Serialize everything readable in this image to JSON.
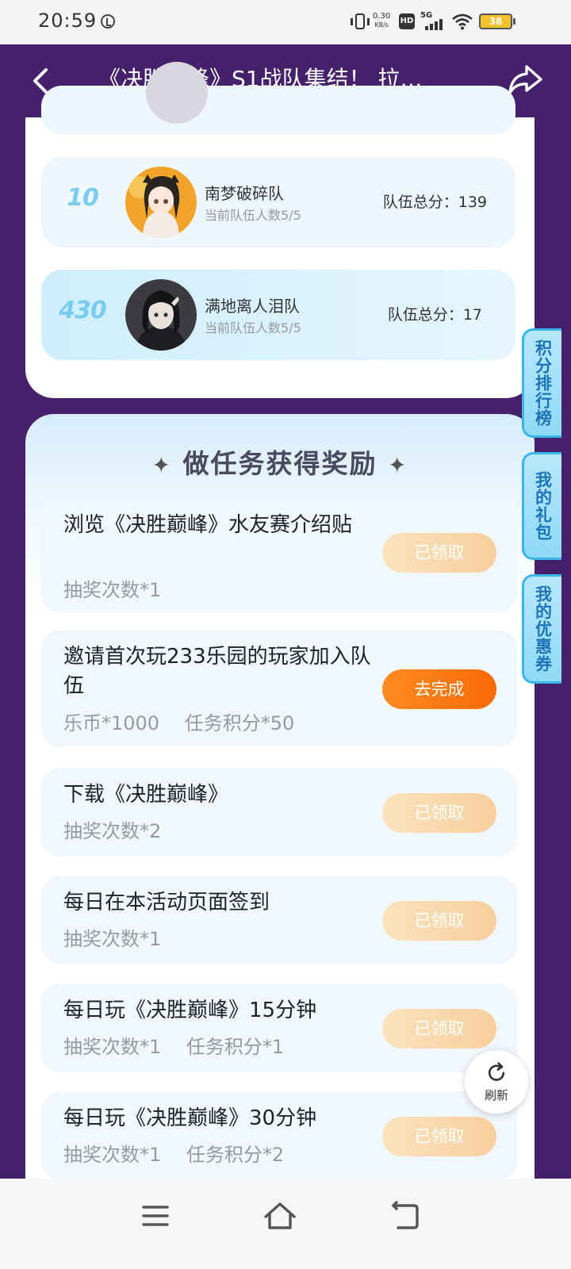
{
  "status_bar": {
    "time": "20:59",
    "net_speed_value": "0.30",
    "net_speed_unit": "KB/s",
    "hd": "HD",
    "network": "5G",
    "battery": "38"
  },
  "header": {
    "title": "《决胜巅峰》S1战队集结！ 拉…"
  },
  "teams": [
    {
      "rank": "10",
      "name": "南梦破碎队",
      "members": "当前队伍人数5/5",
      "score": "队伍总分：139"
    },
    {
      "rank": "430",
      "name": "满地离人泪队",
      "members": "当前队伍人数5/5",
      "score": "队伍总分：17"
    }
  ],
  "tasks_section": {
    "title": "做任务获得奖励",
    "star": "✦"
  },
  "tasks": [
    {
      "title": "浏览《决胜巅峰》水友赛介绍贴",
      "rewards": [
        "抽奖次数*1"
      ],
      "button": "已领取",
      "state": "claimed"
    },
    {
      "title": "邀请首次玩233乐园的玩家加入队伍",
      "rewards": [
        "乐币*1000",
        "任务积分*50"
      ],
      "button": "去完成",
      "state": "todo"
    },
    {
      "title": "下载《决胜巅峰》",
      "rewards": [
        "抽奖次数*2"
      ],
      "button": "已领取",
      "state": "claimed"
    },
    {
      "title": "每日在本活动页面签到",
      "rewards": [
        "抽奖次数*1"
      ],
      "button": "已领取",
      "state": "claimed"
    },
    {
      "title": "每日玩《决胜巅峰》15分钟",
      "rewards": [
        "抽奖次数*1",
        "任务积分*1"
      ],
      "button": "已领取",
      "state": "claimed"
    },
    {
      "title": "每日玩《决胜巅峰》30分钟",
      "rewards": [
        "抽奖次数*1",
        "任务积分*2"
      ],
      "button": "已领取",
      "state": "claimed"
    }
  ],
  "side_tabs": [
    "积分排行榜",
    "我的礼包",
    "我的优惠券"
  ],
  "refresh": {
    "label": "刷新"
  },
  "colors": {
    "header_bg": "#45206b",
    "accent_orange": "#f96a06",
    "claimed_button": "#f8cf9e",
    "rank_blue": "#7bcdf0",
    "side_tab_text": "#1d74b8"
  }
}
